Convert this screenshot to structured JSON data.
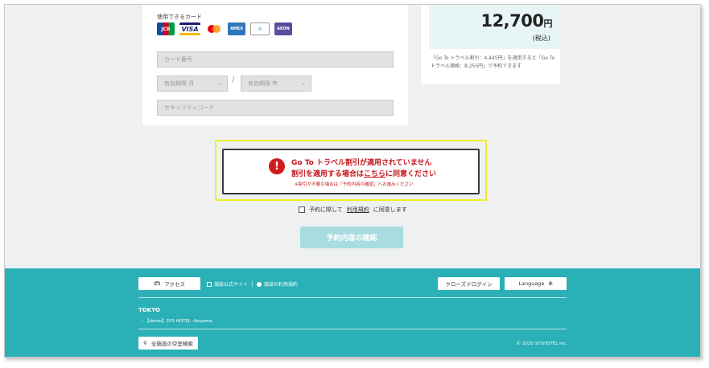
{
  "payment": {
    "cards_label": "使用できるカード",
    "brands": [
      "JCB",
      "VISA",
      "Mastercard",
      "AMEX",
      "Diners Club",
      "AEON"
    ],
    "card_number_placeholder": "カード番号",
    "exp_month_placeholder": "有効期限 月",
    "exp_year_placeholder": "有効期限 年",
    "security_code_placeholder": "セキュリティコード"
  },
  "price": {
    "amount": "12,700",
    "currency": "円",
    "tax_note": "(税込)",
    "goto_note": "「Go To トラベル割引：4,445円」を適用すると「Go To トラベル価格：8,255円」で予約できます"
  },
  "warning": {
    "line1": "Go To トラベル割引が適用されていません",
    "line2_pre": "割引を適用する場合は",
    "line2_link": "こちら",
    "line2_post": "に同意ください",
    "small": "※割引が不要な場合は「予約内容の確認」へお進みください"
  },
  "agreement": {
    "pre": "予約に際して",
    "link": "利用規約",
    "post": "に同意します"
  },
  "confirm_button": "予約内容の確認",
  "footer": {
    "access": "アクセス",
    "official_site": "施設公式サイト",
    "separator": "|",
    "facility_terms": "施設の利用規約",
    "closed_login": "クローズドログイン",
    "language": "Language",
    "region": "TOKYO",
    "hotel": "【demo】SYS HOTEL -Aoyama-",
    "search_all": "全施設の空室検索",
    "copyright": "© 2020 SYSHOTEL Inc."
  },
  "colors": {
    "accent": "#2ab0b6",
    "warning_red": "#c8161d",
    "highlight": "#f2ee2a",
    "confirm_disabled": "#a9dcdf"
  }
}
